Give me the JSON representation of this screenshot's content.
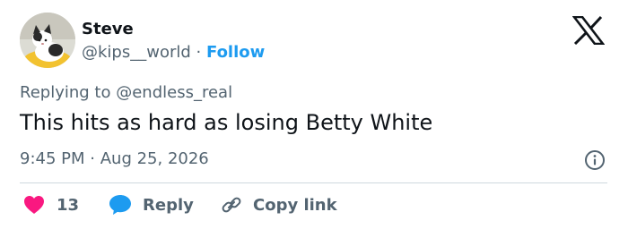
{
  "author": {
    "name": "Steve",
    "handle": "@kips__world",
    "separator": "·",
    "follow_label": "Follow"
  },
  "tweet": {
    "reply_prefix": "Replying to",
    "reply_handle": "@endless_real",
    "text": "This hits as hard as losing Betty White",
    "time": "9:45 PM",
    "date_separator": "·",
    "date": "Aug 25, 2026"
  },
  "actions": {
    "likes": "13",
    "reply_label": "Reply",
    "copy_link_label": "Copy link"
  },
  "colors": {
    "accent": "#1d9bf0",
    "like": "#f91880",
    "secondary_text": "#536471"
  },
  "icons": {
    "logo": "x-logo-icon",
    "info": "info-icon",
    "like": "heart-icon",
    "reply": "speech-bubble-icon",
    "copy": "link-icon"
  }
}
